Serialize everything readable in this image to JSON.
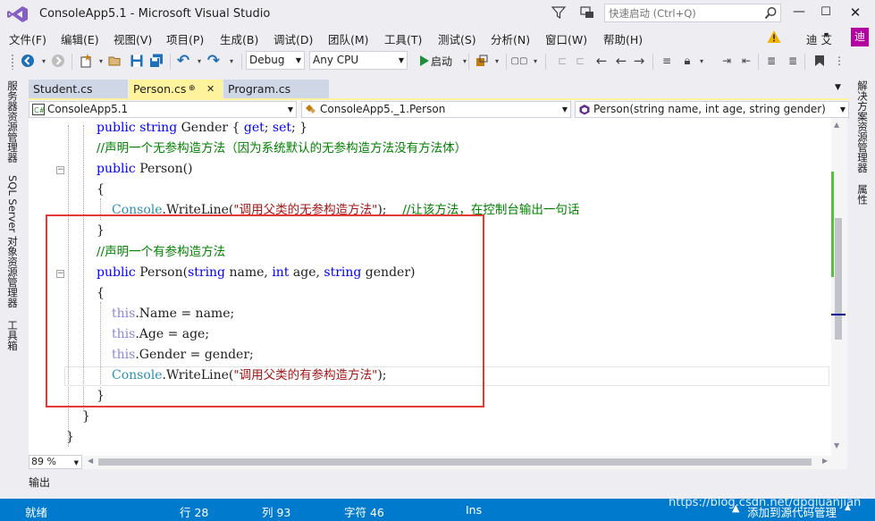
{
  "window": {
    "title": "ConsoleApp5.1 - Microsoft Visual Studio",
    "quick_launch_placeholder": "快速启动 (Ctrl+Q)",
    "min_glyph": "—",
    "max_glyph": "☐",
    "close_glyph": "✕"
  },
  "menu": {
    "items": [
      "文件(F)",
      "编辑(E)",
      "视图(V)",
      "项目(P)",
      "生成(B)",
      "调试(D)",
      "团队(M)",
      "工具(T)",
      "测试(S)",
      "分析(N)",
      "窗口(W)",
      "帮助(H)"
    ],
    "user_name": "迪 艾",
    "user_avatar_initial": "迪"
  },
  "toolbar": {
    "configuration": "Debug",
    "platform": "Any CPU",
    "start_label": "启动"
  },
  "left_rail": {
    "tabs": [
      "服务器资源管理器",
      "SQL Server 对象资源管理器",
      "工具箱"
    ]
  },
  "right_rail": {
    "tabs": [
      "解决方案资源管理器",
      "属性"
    ]
  },
  "doc_tabs": {
    "items": [
      {
        "label": "Student.cs"
      },
      {
        "label": "Person.cs",
        "pin": "⊕",
        "close": "✕"
      },
      {
        "label": "Program.cs"
      }
    ],
    "overflow_glyph": "▼"
  },
  "navbar": {
    "project": "ConsoleApp5.1",
    "class": "ConsoleApp5._1.Person",
    "member": "Person(string name, int age, string gender)"
  },
  "code": {
    "line1": {
      "kw1": "public",
      "kw2": "string",
      "text1": " Gender { ",
      "kw3": "get",
      "text2": "; ",
      "kw4": "set",
      "text3": "; }"
    },
    "line2": {
      "comment": "//声明一个无参构造方法（因为系统默认的无参构造方法没有方法体）"
    },
    "line3": {
      "kw": "public",
      "text": " Person()"
    },
    "line4": {
      "brace": "{"
    },
    "line5": {
      "type": "Console",
      "method": ".WriteLine(",
      "str": "\"调用父类的无参构造方法\"",
      "end": ");",
      "comment": "//让该方法，在控制台输出一句话"
    },
    "line6": {
      "brace": "}"
    },
    "line7": {
      "comment": "//声明一个有参构造方法"
    },
    "line8": {
      "kw1": "public",
      "text1": " Person(",
      "kw2": "string",
      "text2": " name, ",
      "kw3": "int",
      "text3": " age, ",
      "kw4": "string",
      "text4": " gender)"
    },
    "line9": {
      "brace": "{"
    },
    "line10": {
      "kw": "this",
      "text": ".Name = name;"
    },
    "line11": {
      "kw": "this",
      "text": ".Age = age;"
    },
    "line12": {
      "kw": "this",
      "text": ".Gender = gender;"
    },
    "line13": {
      "type": "Console",
      "method": ".WriteLine(",
      "str": "\"调用父类的有参构造方法\"",
      "end": ");"
    },
    "line14": {
      "brace": "}"
    },
    "line15": {
      "brace": "}"
    },
    "line16": {
      "brace": "}"
    }
  },
  "editor": {
    "zoom": "89 %"
  },
  "output_tab": "输出",
  "status": {
    "ready": "就绪",
    "line": "行 28",
    "col": "列 93",
    "char": "字符 46",
    "mode": "Ins",
    "source_control": "添加到源代码管理",
    "watermark": "https://blog.csdn.net/dpqiuanjian"
  },
  "colors": {
    "accent": "#007ACC",
    "active_tab": "#FFF29D",
    "annotation": "#E53935",
    "keyword": "#0000FF",
    "type": "#2B91AF",
    "string": "#A31515",
    "comment": "#008000"
  },
  "icons": [
    "vs-logo-icon",
    "filter-icon",
    "feedback-icon",
    "search-icon",
    "warning-icon",
    "back-icon",
    "forward-icon",
    "new-project-icon",
    "open-icon",
    "save-icon",
    "save-all-icon",
    "undo-icon",
    "redo-icon",
    "start-icon",
    "class-icon",
    "method-icon"
  ]
}
